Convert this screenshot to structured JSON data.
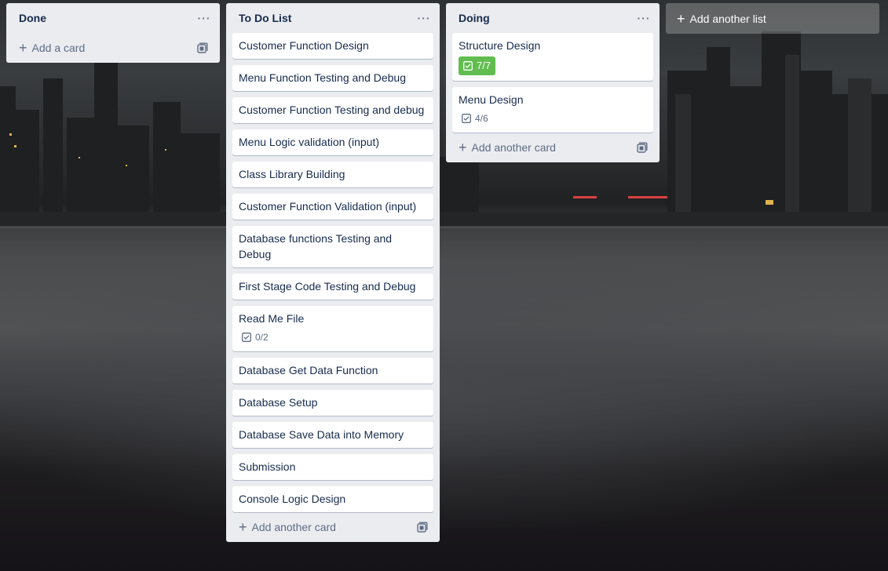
{
  "lists": [
    {
      "title": "Done",
      "cards": [],
      "add_label": "Add a card"
    },
    {
      "title": "To Do List",
      "cards": [
        {
          "title": "Customer Function Design"
        },
        {
          "title": "Menu Function Testing and Debug"
        },
        {
          "title": "Customer Function Testing and debug"
        },
        {
          "title": "Menu Logic validation (input)"
        },
        {
          "title": "Class Library Building"
        },
        {
          "title": "Customer Function Validation (input)"
        },
        {
          "title": "Database functions Testing and Debug"
        },
        {
          "title": "First Stage Code Testing and Debug"
        },
        {
          "title": "Read Me File",
          "checklist": "0/2"
        },
        {
          "title": "Database Get Data Function"
        },
        {
          "title": "Database Setup"
        },
        {
          "title": "Database Save Data into Memory"
        },
        {
          "title": "Submission"
        },
        {
          "title": "Console Logic Design"
        }
      ],
      "add_label": "Add another card"
    },
    {
      "title": "Doing",
      "cards": [
        {
          "title": "Structure Design",
          "checklist": "7/7",
          "complete": true
        },
        {
          "title": "Menu Design",
          "checklist": "4/6"
        }
      ],
      "add_label": "Add another card"
    }
  ],
  "add_list_label": "Add another list",
  "colors": {
    "list_bg": "#ebecf0",
    "card_bg": "#ffffff",
    "text": "#172b4d",
    "muted": "#5e6c84",
    "complete_badge": "#61bd4f"
  },
  "icons": {
    "menu": "more-horizontal-icon",
    "add": "plus-icon",
    "template": "card-template-icon",
    "checklist": "checkbox-icon"
  }
}
